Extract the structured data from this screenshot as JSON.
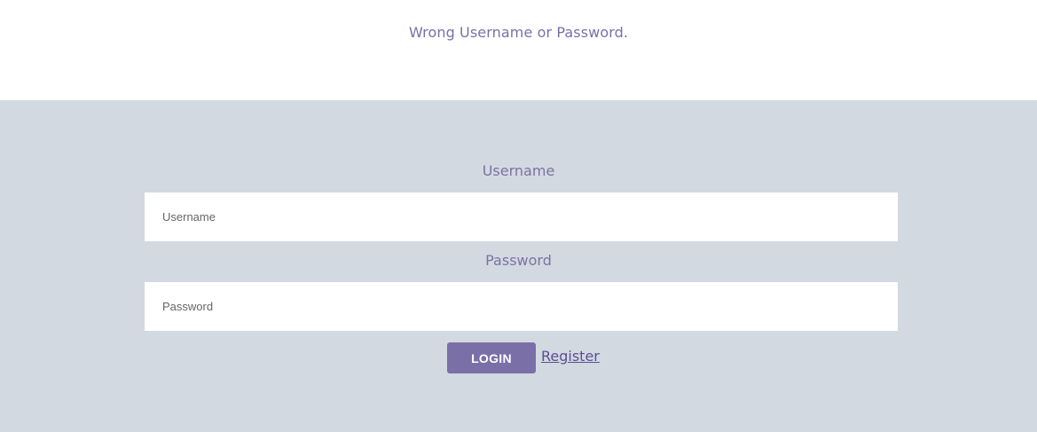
{
  "error": {
    "message": "Wrong Username or Password."
  },
  "form": {
    "username_label": "Username",
    "username_placeholder": "Username",
    "password_label": "Password",
    "password_placeholder": "Password",
    "login_label": "LOGIN",
    "register_label": "Register"
  },
  "colors": {
    "accent": "#7b6fa8",
    "form_background": "#d3d9e1",
    "link": "#5b4e94"
  }
}
